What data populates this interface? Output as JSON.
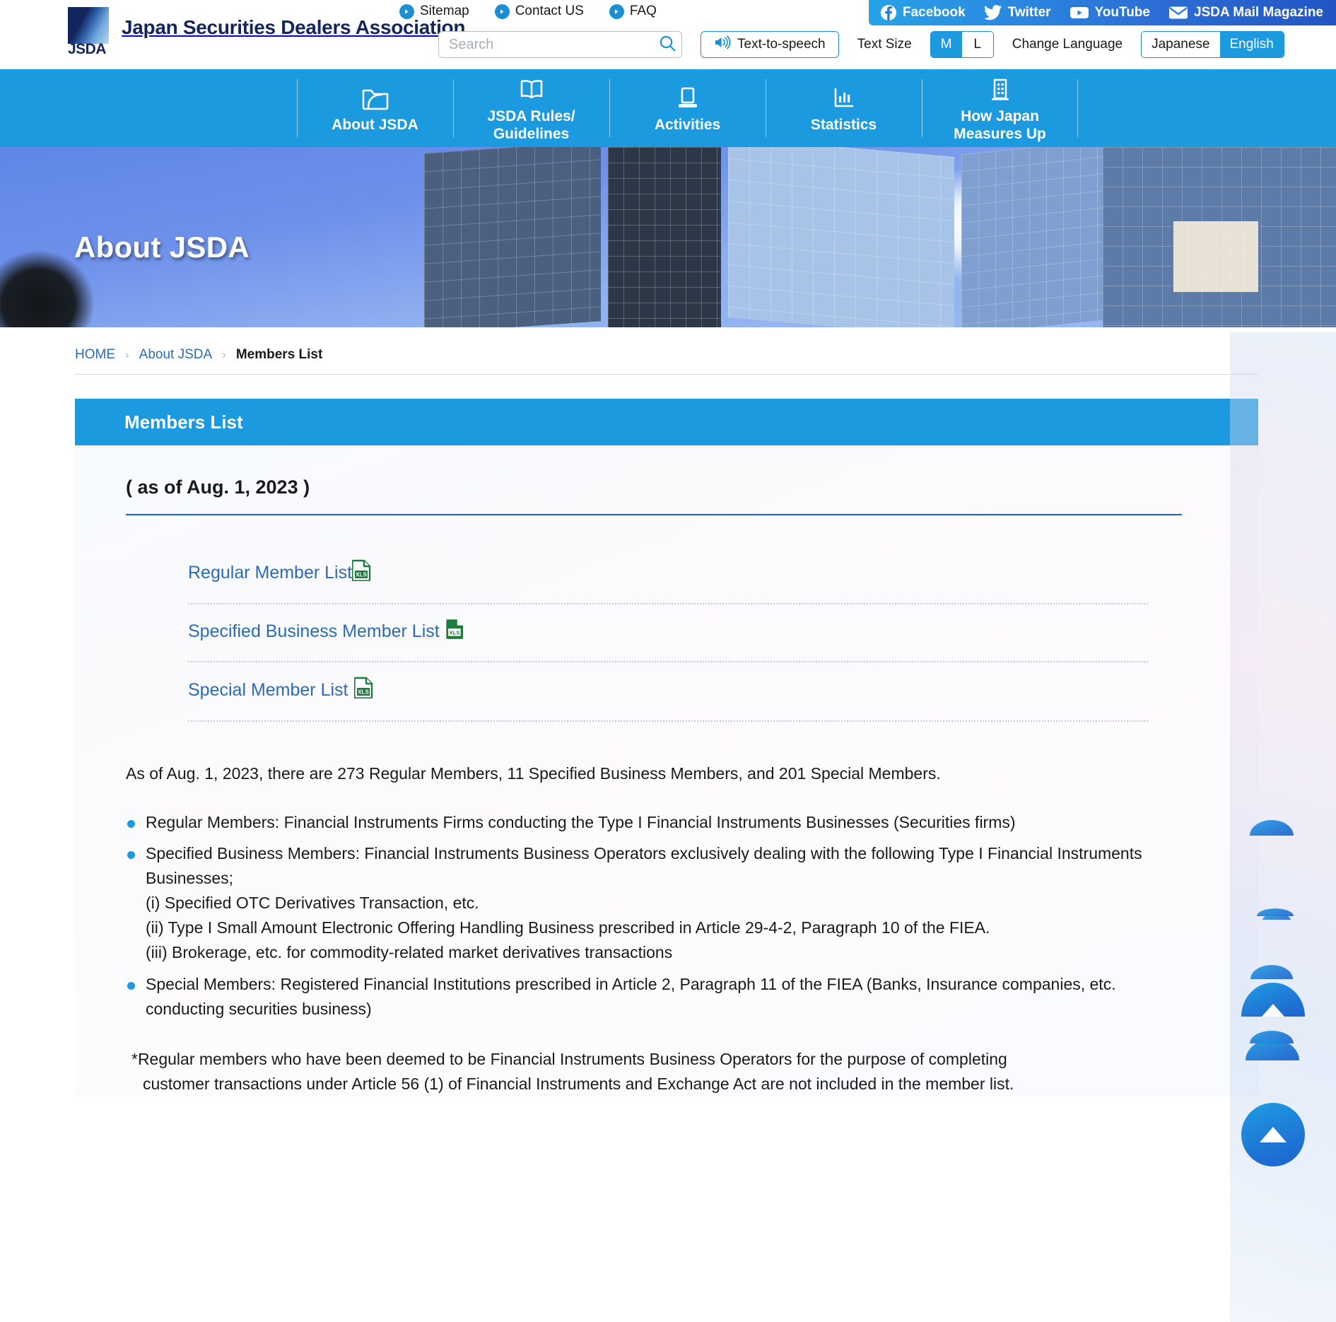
{
  "brand": {
    "abbr": "JSDA",
    "name": "Japan Securities Dealers Association"
  },
  "utility": {
    "links": [
      {
        "label": "Sitemap",
        "icon": "arrow-right-circle-icon"
      },
      {
        "label": "Contact US",
        "icon": "arrow-right-circle-icon"
      },
      {
        "label": "FAQ",
        "icon": "arrow-right-circle-icon"
      }
    ],
    "social": [
      {
        "label": "Facebook",
        "icon": "facebook-icon"
      },
      {
        "label": "Twitter",
        "icon": "twitter-icon"
      },
      {
        "label": "YouTube",
        "icon": "youtube-icon"
      },
      {
        "label": "JSDA Mail Magazine",
        "icon": "mail-icon"
      }
    ],
    "search": {
      "value": "",
      "placeholder": "Search",
      "icon": "search-icon"
    },
    "tts": {
      "label": "Text-to-speech",
      "icon": "speaker-icon"
    },
    "text_size": {
      "label": "Text Size",
      "options": [
        "M",
        "L"
      ],
      "selected": "M"
    },
    "language": {
      "label": "Change Language",
      "options": [
        "Japanese",
        "English"
      ],
      "selected": "English"
    }
  },
  "nav": {
    "items": [
      {
        "label": "About JSDA",
        "icon": "folder-icon"
      },
      {
        "label": "JSDA Rules/\nGuidelines",
        "icon": "book-icon"
      },
      {
        "label": "Activities",
        "icon": "monitor-icon"
      },
      {
        "label": "Statistics",
        "icon": "bar-chart-icon"
      },
      {
        "label": "How Japan\nMeasures Up",
        "icon": "building-icon"
      }
    ]
  },
  "hero": {
    "title": "About JSDA"
  },
  "breadcrumb": {
    "items": [
      {
        "label": "HOME",
        "current": false
      },
      {
        "label": "About JSDA",
        "current": false
      },
      {
        "label": "Members List",
        "current": true
      }
    ],
    "separator": "›"
  },
  "main": {
    "page_title": "Members List",
    "as_of": "( as of Aug. 1, 2023 )",
    "downloads": [
      {
        "label": "Regular Member List",
        "file_type": "XLS",
        "icon": "xls-file-icon",
        "spaced": false
      },
      {
        "label": "Specified Business Member List",
        "file_type": "XLS",
        "icon": "xls-file-icon",
        "spaced": true
      },
      {
        "label": "Special Member List",
        "file_type": "XLS",
        "icon": "xls-file-icon",
        "spaced": true
      }
    ],
    "lead": "As of Aug. 1, 2023, there are 273 Regular Members, 11 Specified Business Members, and 201 Special Members.",
    "bullets": [
      "Regular Members: Financial Instruments Firms conducting the Type I Financial Instruments Businesses (Securities firms)",
      "Specified Business Members: Financial Instruments Business Operators exclusively dealing with the following Type I Financial Instruments Businesses;\n(i) Specified OTC Derivatives Transaction, etc.\n(ii) Type I Small Amount Electronic Offering Handling Business prescribed in Article 29-4-2, Paragraph 10 of the FIEA.\n(iii) Brokerage, etc. for commodity-related market derivatives transactions",
      "Special Members: Registered Financial Institutions prescribed in Article 2, Paragraph 11 of the FIEA (Banks, Insurance companies, etc. conducting securities business)"
    ],
    "note_line1": "*Regular members who have been deemed to be Financial Instruments Business Operators for the purpose of completing",
    "note_line2": "customer transactions under Article 56 (1) of Financial Instruments and Exchange Act are not included in the member list."
  },
  "widgets": {
    "scroll_to_top": {
      "label": "Scroll to top",
      "icon": "triangle-up-icon"
    }
  },
  "colors": {
    "brand_blue": "#1b9ae0",
    "navy": "#12255c",
    "link_blue": "#2b6bb5",
    "xls_green": "#1f7a3e",
    "social_gradient_start": "#27a3e8",
    "social_gradient_end": "#2255c4"
  }
}
